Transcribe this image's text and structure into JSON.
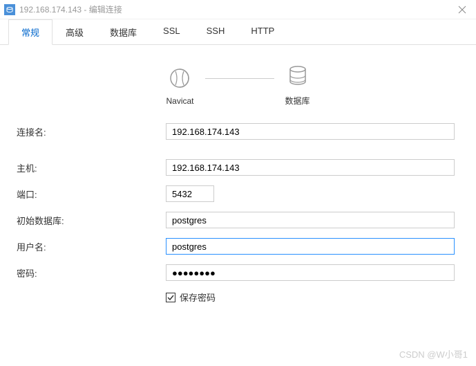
{
  "titlebar": {
    "title": "192.168.174.143 - 编辑连接"
  },
  "tabs": [
    {
      "label": "常规",
      "active": true
    },
    {
      "label": "高级",
      "active": false
    },
    {
      "label": "数据库",
      "active": false
    },
    {
      "label": "SSL",
      "active": false
    },
    {
      "label": "SSH",
      "active": false
    },
    {
      "label": "HTTP",
      "active": false
    }
  ],
  "diagram": {
    "left_label": "Navicat",
    "right_label": "数据库"
  },
  "form": {
    "connection_name": {
      "label": "连接名:",
      "value": "192.168.174.143"
    },
    "host": {
      "label": "主机:",
      "value": "192.168.174.143"
    },
    "port": {
      "label": "端口:",
      "value": "5432"
    },
    "initial_db": {
      "label": "初始数据库:",
      "value": "postgres"
    },
    "username": {
      "label": "用户名:",
      "value": "postgres"
    },
    "password": {
      "label": "密码:",
      "value": "●●●●●●●●"
    },
    "save_password": {
      "label": "保存密码",
      "checked": true
    }
  },
  "watermark": "CSDN @W小哥1"
}
